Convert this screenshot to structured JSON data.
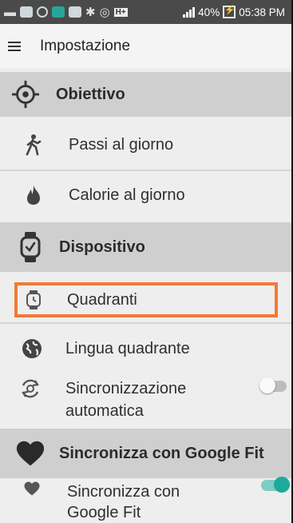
{
  "status_bar": {
    "battery_percent": "40%",
    "time": "05:38 PM",
    "network_badge": "H+"
  },
  "app_bar": {
    "title": "Impostazione"
  },
  "sections": {
    "obiettivo": {
      "label": "Obiettivo",
      "items": [
        {
          "label": "Passi al giorno"
        },
        {
          "label": "Calorie al giorno"
        }
      ]
    },
    "dispositivo": {
      "label": "Dispositivo",
      "items": [
        {
          "label": "Quadranti"
        },
        {
          "label": "Lingua quadrante"
        },
        {
          "label_line1": "Sincronizzazione",
          "label_line2": "automatica",
          "toggle": "off"
        }
      ]
    },
    "google_fit": {
      "label": "Sincronizza con Google Fit",
      "items": [
        {
          "label_line1": "Sincronizza con",
          "label_line2": "Google Fit",
          "toggle": "on"
        }
      ]
    }
  },
  "colors": {
    "status_bar": "#4a4a4a",
    "section_header": "#cfcfcf",
    "background": "#eeeeee",
    "highlight": "#f07b34",
    "toggle_on": "#1ea99d"
  }
}
